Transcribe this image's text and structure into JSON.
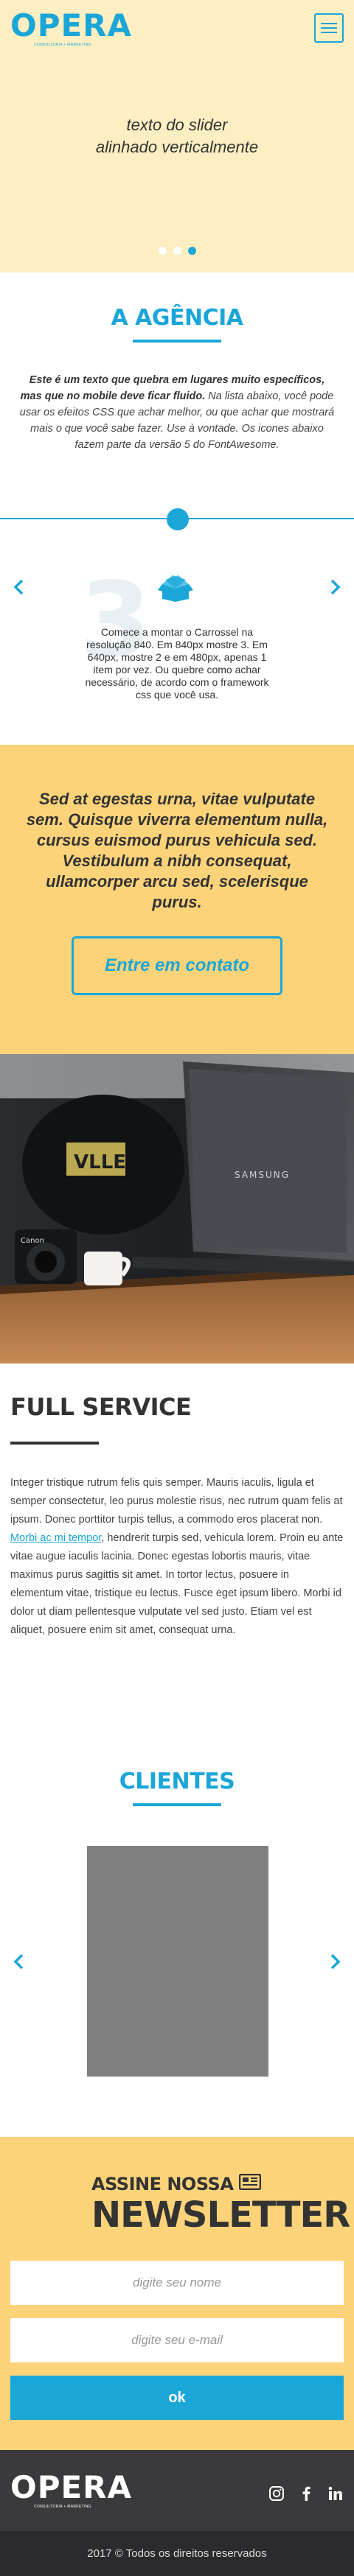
{
  "header": {
    "brand": "OPERA",
    "tagline": "CONSULTORIA + MARKETING",
    "menu_icon": "hamburger-icon"
  },
  "hero": {
    "line1": "texto do slider",
    "line2": "alinhado verticalmente",
    "slide_count": 3,
    "active_slide": 3
  },
  "agencia": {
    "title": "A AGÊNCIA",
    "text_bold": "Este é um texto que quebra em lugares muito específicos, mas que no mobile  deve ficar fluido.",
    "text_rest": " Na lista abaixo, você pode usar os efeitos CSS que achar melhor, ou que achar que mostrará mais o que você sabe fazer. Use à vontade. Os icones abaixo fazem parte da versão 5 do FontAwesome."
  },
  "carrossel": {
    "number": "3",
    "icon": "box-open-icon",
    "text": "Comece a montar o Carrossel na resolução 840. Em 840px mostre 3. Em 640px, mostre 2 e em 480px, apenas 1 item por vez. Ou quebre como achar necessário, de acordo com o framework css que você usa.",
    "prev_icon": "chevron-left-icon",
    "next_icon": "chevron-right-icon"
  },
  "cta": {
    "quote": "Sed at egestas urna, vitae vulputate sem. Quisque viverra elementum nulla, cursus euismod purus vehicula sed. Vestibulum a nibh consequat, ullamcorper arcu sed, scelerisque purus.",
    "button": "Entre em contato"
  },
  "photo": {
    "laptop_brand": "SAMSUNG",
    "camera_brand": "Canon"
  },
  "full_service": {
    "title": "FULL SERVICE",
    "text_before": "Integer tristique rutrum felis quis semper. Mauris iaculis, ligula et semper consectetur, leo purus molestie risus, nec rutrum quam felis at ipsum. Donec porttitor turpis tellus, a commodo eros placerat non. ",
    "link": "Morbi ac mi tempor",
    "text_after": ", hendrerit turpis sed, vehicula lorem. Proin eu ante vitae augue iaculis lacinia. Donec egestas lobortis mauris, vitae maximus purus sagittis sit amet. In tortor lectus, posuere in elementum vitae, tristique eu lectus. Fusce eget ipsum libero. Morbi id dolor ut diam pellentesque vulputate vel sed justo. Etiam vel est aliquet, posuere enim sit amet, consequat urna."
  },
  "clientes": {
    "title": "CLIENTES"
  },
  "newsletter": {
    "small": "ASSINE NOSSA",
    "big": "NEWSLETTER",
    "icon": "newspaper-icon",
    "name_placeholder": "digite seu nome",
    "email_placeholder": "digite seu e-mail",
    "button": "ok"
  },
  "footer": {
    "brand": "OPERA",
    "tagline": "CONSULTORIA + MARKETING",
    "social": [
      "instagram-icon",
      "facebook-icon",
      "linkedin-icon"
    ],
    "copyright": "2017 © Todos os direitos reservados"
  },
  "colors": {
    "accent": "#1ba6d8",
    "yellow": "#fdd37a",
    "light_yellow": "#fdefc2",
    "footer": "#3a3a3c"
  }
}
